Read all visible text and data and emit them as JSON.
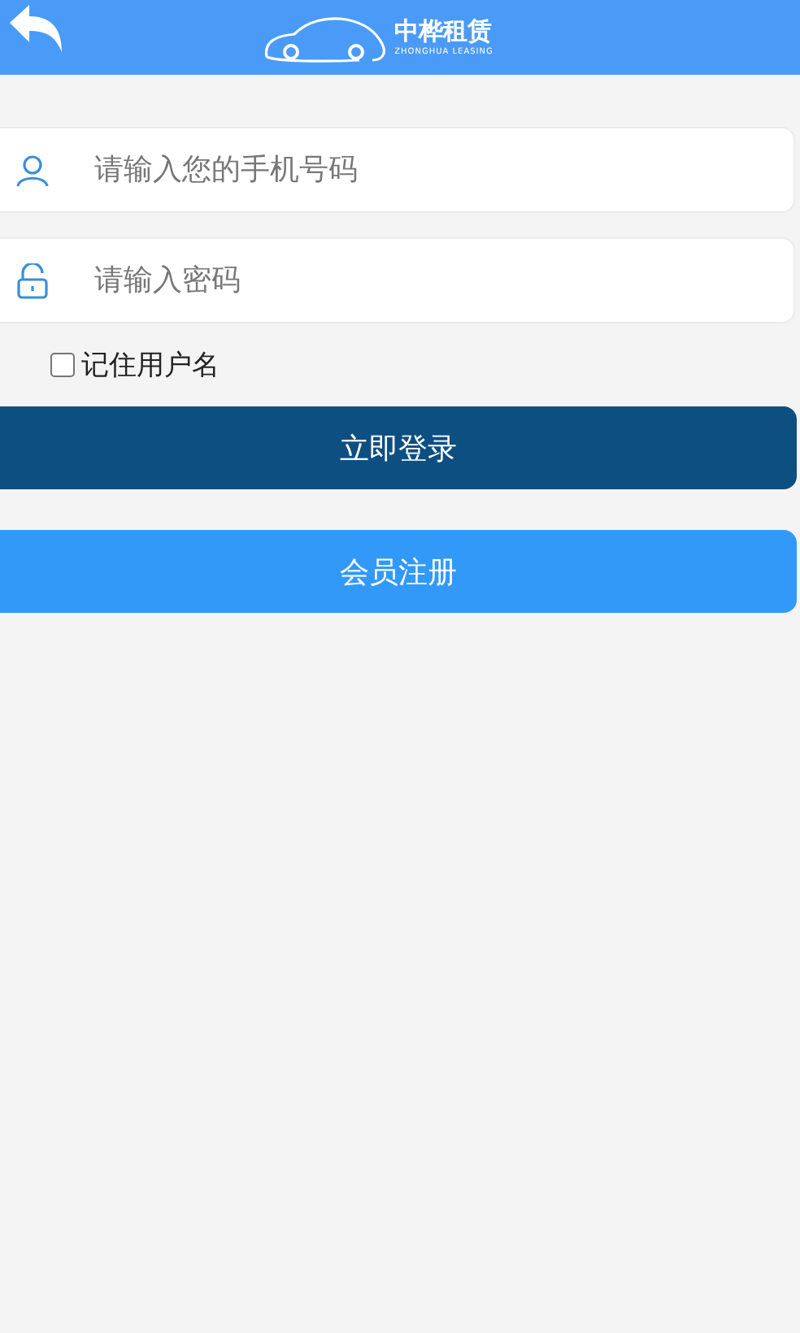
{
  "header": {
    "brand_name": "中桦租赁",
    "brand_subtitle": "ZHONGHUA LEASING"
  },
  "fields": [
    {
      "kind": "user",
      "placeholder": "请输入您的手机号码"
    },
    {
      "kind": "lock",
      "placeholder": "请输入密码"
    }
  ],
  "remember": {
    "label": "记住用户名",
    "checked": false
  },
  "buttons": [
    {
      "kind": "primary",
      "label": "立即登录"
    },
    {
      "kind": "secondary",
      "label": "会员注册"
    }
  ]
}
